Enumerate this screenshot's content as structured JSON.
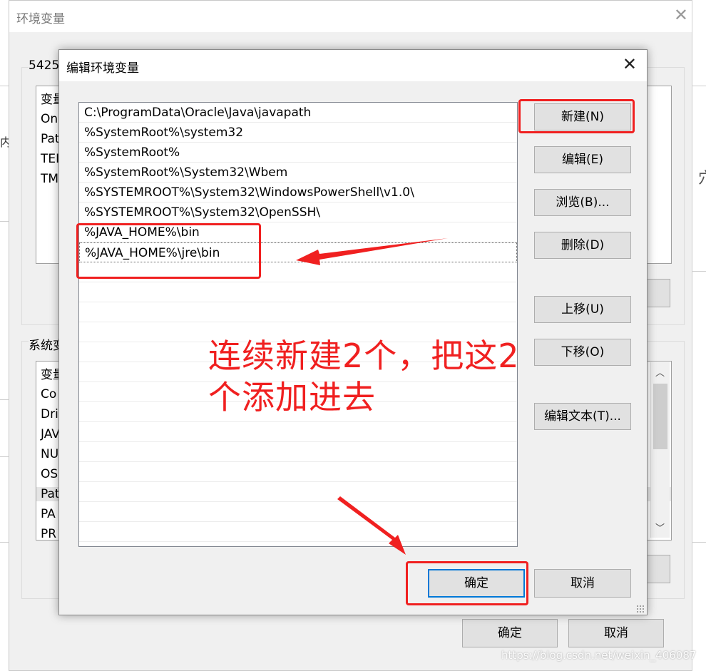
{
  "outer_dialog": {
    "title": "环境变量",
    "close_glyph": "✕",
    "user_vars_label": "5425",
    "user_vars": {
      "header": "变量",
      "rows": [
        "On",
        "Pat",
        "TEI",
        "TM"
      ]
    },
    "system_vars_label": "系统变",
    "system_vars": {
      "header": "变量",
      "rows": [
        "Co",
        "Dri",
        "JAV",
        "NU",
        "OS",
        "Pat",
        "PA",
        "PR"
      ]
    },
    "ok_label": "确定",
    "cancel_label": "取消",
    "left_edge_fragment": "内",
    "right_edge_fragment": "穴"
  },
  "edit_dialog": {
    "title": "编辑环境变量",
    "close_glyph": "✕",
    "paths": [
      "C:\\ProgramData\\Oracle\\Java\\javapath",
      "%SystemRoot%\\system32",
      "%SystemRoot%",
      "%SystemRoot%\\System32\\Wbem",
      "%SYSTEMROOT%\\System32\\WindowsPowerShell\\v1.0\\",
      "%SYSTEMROOT%\\System32\\OpenSSH\\",
      "%JAVA_HOME%\\bin",
      "%JAVA_HOME%\\jre\\bin"
    ],
    "selected_index": 7,
    "buttons": {
      "new": "新建(N)",
      "edit": "编辑(E)",
      "browse": "浏览(B)...",
      "delete": "删除(D)",
      "move_up": "上移(U)",
      "move_down": "下移(O)",
      "edit_text": "编辑文本(T)..."
    },
    "ok_label": "确定",
    "cancel_label": "取消"
  },
  "annotation": {
    "line1": "连续新建2个，把这2",
    "line2": "个添加进去",
    "color": "#f02020"
  },
  "watermark": "https://blog.csdn.net/weixin_406087"
}
